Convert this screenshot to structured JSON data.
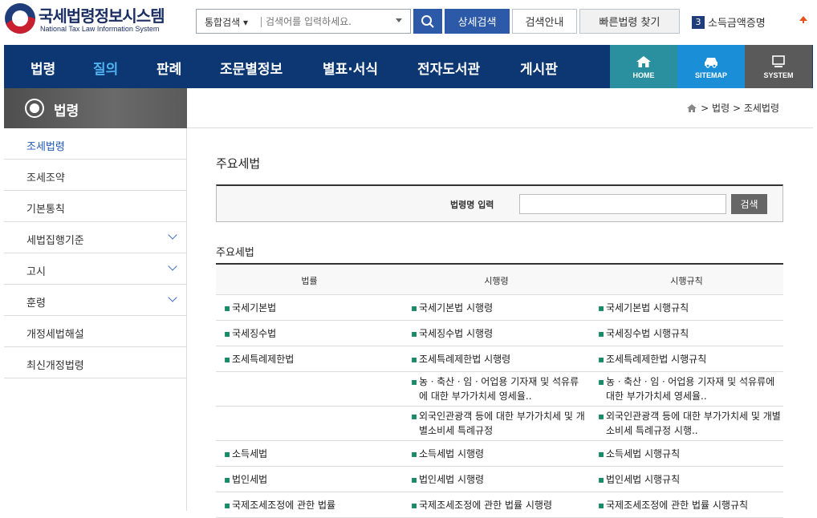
{
  "header": {
    "logo_kr": "국세법령정보시스템",
    "logo_en": "National Tax Law Information System",
    "search_type": "통합검색",
    "search_placeholder": "검색어를 입력하세요.",
    "detail_search": "상세검색",
    "search_guide": "검색안내",
    "quick_law": "빠른법령 찾기",
    "rank_number": "3",
    "rank_text": "소득금액증명"
  },
  "gnb": {
    "items": [
      "법령",
      "질의",
      "판례",
      "조문별정보",
      "별표·서식",
      "전자도서관",
      "게시판"
    ],
    "home": "HOME",
    "sitemap": "SITEMAP",
    "system": "SYSTEM"
  },
  "sidebar": {
    "title": "법령",
    "items": [
      "조세법령",
      "조세조약",
      "기본통칙",
      "세법집행기준",
      "고시",
      "훈령",
      "개정세법해설",
      "최신개정법령"
    ]
  },
  "breadcrumb": {
    "level1": "법령",
    "level2": "조세법령"
  },
  "main": {
    "title": "주요세법",
    "search_label": "법령명 입력",
    "search_button": "검색",
    "section_title": "주요세법",
    "table_headers": [
      "법률",
      "시행령",
      "시행규칙"
    ],
    "rows": [
      {
        "law": "국세기본법",
        "decree": "국세기본법 시행령",
        "rule": "국세기본법 시행규칙"
      },
      {
        "law": "국세징수법",
        "decree": "국세징수법 시행령",
        "rule": "국세징수법 시행규칙"
      },
      {
        "law": "조세특례제한법",
        "decree": "조세특례제한법 시행령",
        "rule": "조세특례제한법 시행규칙"
      },
      {
        "law": "",
        "decree": "농ㆍ축산ㆍ임ㆍ어업용 기자재 및 석유류에 대한 부가가치세 영세율..",
        "rule": "농ㆍ축산ㆍ임ㆍ어업용 기자재 및 석유류에 대한 부가가치세 영세율.."
      },
      {
        "law": "",
        "decree": "외국인관광객 등에 대한 부가가치세 및 개별소비세 특례규정",
        "rule": "외국인관광객 등에 대한 부가가치세 및 개별소비세 특례규정 시행.."
      },
      {
        "law": "소득세법",
        "decree": "소득세법 시행령",
        "rule": "소득세법 시행규칙"
      },
      {
        "law": "법인세법",
        "decree": "법인세법 시행령",
        "rule": "법인세법 시행규칙"
      },
      {
        "law": "국제조세조정에 관한 법률",
        "decree": "국제조세조정에 관한 법률 시행령",
        "rule": "국제조세조정에 관한 법률 시행규칙"
      }
    ]
  }
}
